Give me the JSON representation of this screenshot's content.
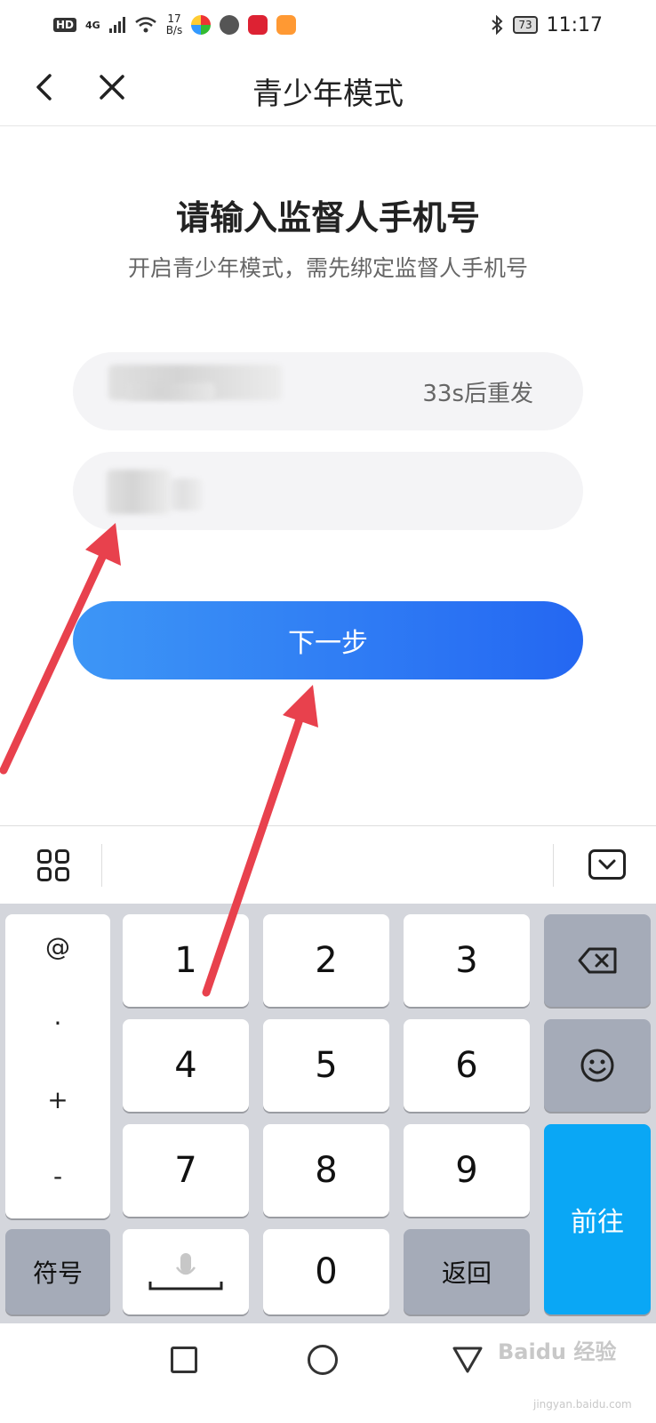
{
  "status_bar": {
    "network": "4G",
    "speed_value": "17",
    "speed_unit": "B/s",
    "battery": "73",
    "time": "11:17"
  },
  "header": {
    "title": "青少年模式"
  },
  "main": {
    "heading": "请输入监督人手机号",
    "subheading": "开启青少年模式，需先绑定监督人手机号",
    "resend_label": "33s后重发",
    "next_button": "下一步"
  },
  "keyboard": {
    "symbols": [
      "@",
      "·",
      "+",
      "-"
    ],
    "digits": [
      "1",
      "2",
      "3",
      "4",
      "5",
      "6",
      "7",
      "8",
      "9",
      "0"
    ],
    "symbol_key": "符号",
    "back_key": "返回",
    "go_key": "前往"
  },
  "watermark": {
    "brand": "Baidu 经验",
    "url": "jingyan.baidu.com"
  },
  "colors": {
    "accent": "#2467f2",
    "go_key": "#0aa7f5",
    "arrow": "#e8414d"
  }
}
